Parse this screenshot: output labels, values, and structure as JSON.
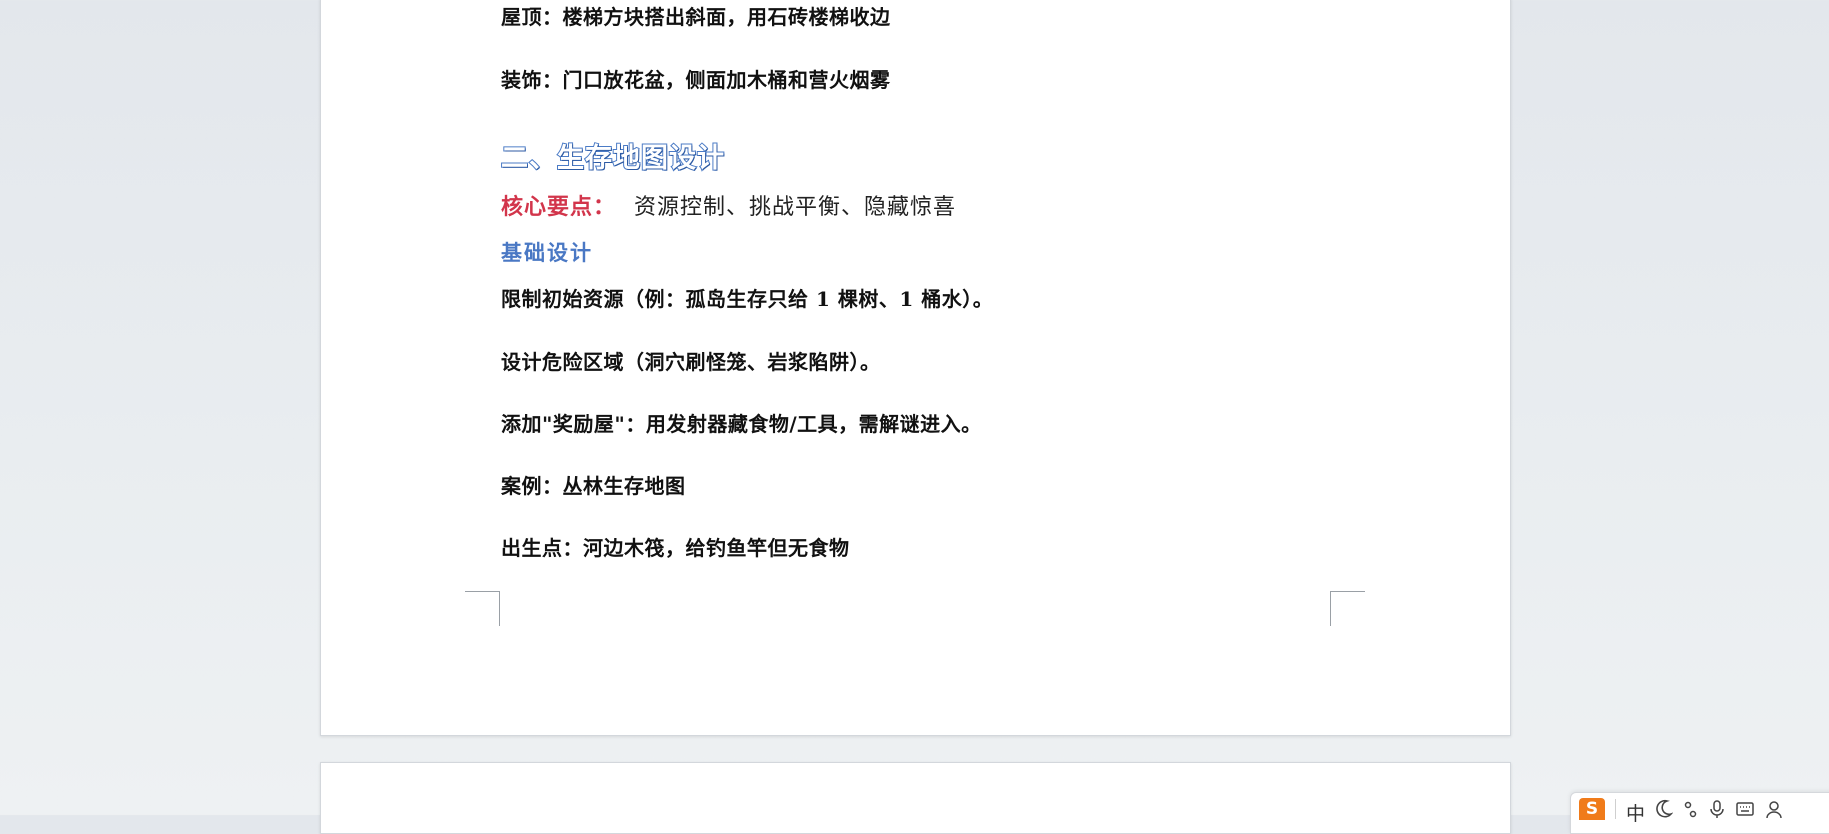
{
  "document": {
    "lines": {
      "roof": "屋顶：楼梯方块搭出斜面，用石砖楼梯收边",
      "decoration": "装饰：门口放花盆，侧面加木桶和营火烟雾",
      "limit_resources": "限制初始资源（例：孤岛生存只给 1 棵树、1 桶水）。",
      "danger_zone": "设计危险区域（洞穴刷怪笼、岩浆陷阱）。",
      "reward_room": "添加\"奖励屋\"：用发射器藏食物/工具，需解谜进入。",
      "case": "案例：丛林生存地图",
      "spawn": "出生点：河边木筏，给钓鱼竿但无食物"
    },
    "section_heading": "二、生存地图设计",
    "key_points": {
      "label": "核心要点：",
      "value": "资源控制、挑战平衡、隐藏惊喜"
    },
    "subheading": "基础设计"
  },
  "ime_toolbar": {
    "logo": "S",
    "mode": "中",
    "icons": [
      "moon-icon",
      "punctuation-icon",
      "microphone-icon",
      "keyboard-icon",
      "user-icon"
    ]
  },
  "colors": {
    "heading_blue": "#4b7bc6",
    "keypoint_red": "#d2354b",
    "ime_orange": "#f07b1a"
  }
}
